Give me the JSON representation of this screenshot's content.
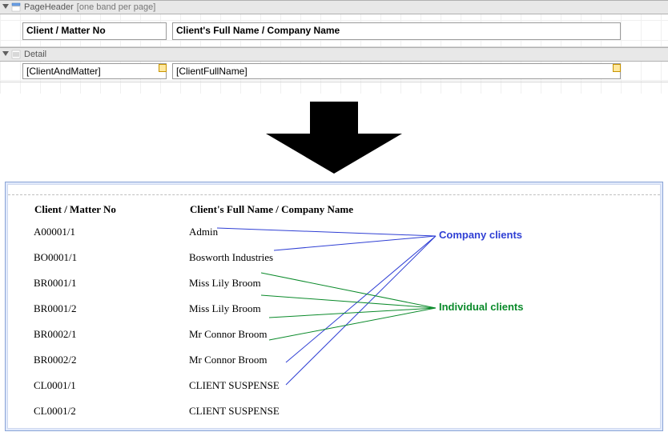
{
  "designer": {
    "pageHeader": {
      "bandName": "PageHeader",
      "bandExtra": "[one band per page]",
      "col1": "Client / Matter No",
      "col2": "Client's Full Name / Company Name"
    },
    "detail": {
      "bandName": "Detail",
      "field1": "[ClientAndMatter]",
      "field2": "[ClientFullName]"
    }
  },
  "preview": {
    "headers": {
      "col1": "Client / Matter No",
      "col2": "Client's Full Name / Company Name"
    },
    "rows": [
      {
        "no": "A00001/1",
        "name": "Admin"
      },
      {
        "no": "BO0001/1",
        "name": "Bosworth Industries"
      },
      {
        "no": "BR0001/1",
        "name": "Miss Lily Broom"
      },
      {
        "no": "BR0001/2",
        "name": "Miss Lily Broom"
      },
      {
        "no": "BR0002/1",
        "name": "Mr Connor Broom"
      },
      {
        "no": "BR0002/2",
        "name": "Mr Connor Broom"
      },
      {
        "no": "CL0001/1",
        "name": "CLIENT SUSPENSE"
      },
      {
        "no": "CL0001/2",
        "name": "CLIENT SUSPENSE"
      }
    ],
    "annotations": {
      "company": "Company clients",
      "individual": "Individual clients"
    }
  }
}
